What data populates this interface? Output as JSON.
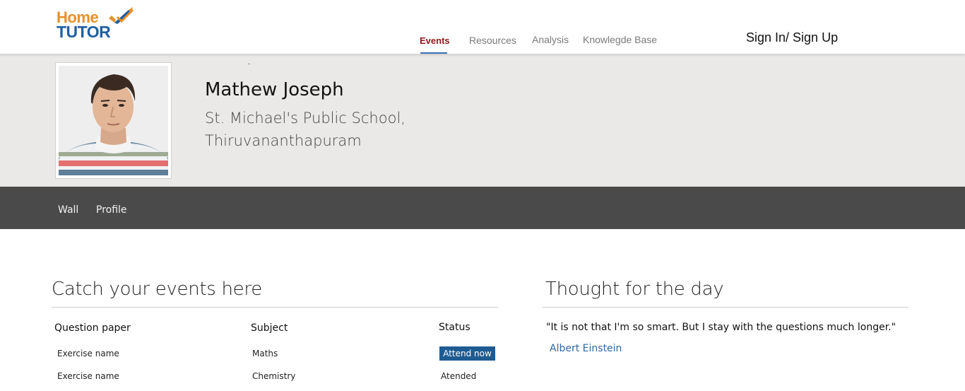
{
  "brand": {
    "logo_top": "Home",
    "logo_bottom": "TUTOR",
    "colors": {
      "home": "#e8902a",
      "tutor": "#1f5fa0"
    }
  },
  "nav": {
    "items": [
      {
        "label": "Events",
        "active": true
      },
      {
        "label": "Resources",
        "active": false
      },
      {
        "label": "Analysis",
        "active": false
      },
      {
        "label": "Knowlegde Base",
        "active": false
      }
    ],
    "signin_label": "Sign In/ Sign Up"
  },
  "profile": {
    "name": "Mathew Joseph",
    "school_line1": "St. Michael's Public School,",
    "school_line2": "Thiruvananthapuram",
    "dot": "."
  },
  "subnav": {
    "items": [
      "Wall",
      "Profile"
    ]
  },
  "events": {
    "title": "Catch your events here",
    "columns": [
      "Question paper",
      "Subject",
      "Status"
    ],
    "rows": [
      {
        "paper": "Exercise name",
        "subject": "Maths",
        "status": "Attend now",
        "actionable": true
      },
      {
        "paper": "Exercise name",
        "subject": "Chemistry",
        "status": "Atended",
        "actionable": false
      }
    ]
  },
  "thought": {
    "title": "Thought for the day",
    "quote": "\"It is not that I'm so smart. But I stay with the questions much longer.\"",
    "author": "Albert Einstein"
  },
  "colors": {
    "accent_red": "#8b1a1a",
    "underline_blue": "#3a6fb0",
    "button_blue": "#1d5b93",
    "link_blue": "#2a6aa8",
    "band_gray": "#ebe9e7",
    "subnav_dark": "#4a4a4a"
  }
}
